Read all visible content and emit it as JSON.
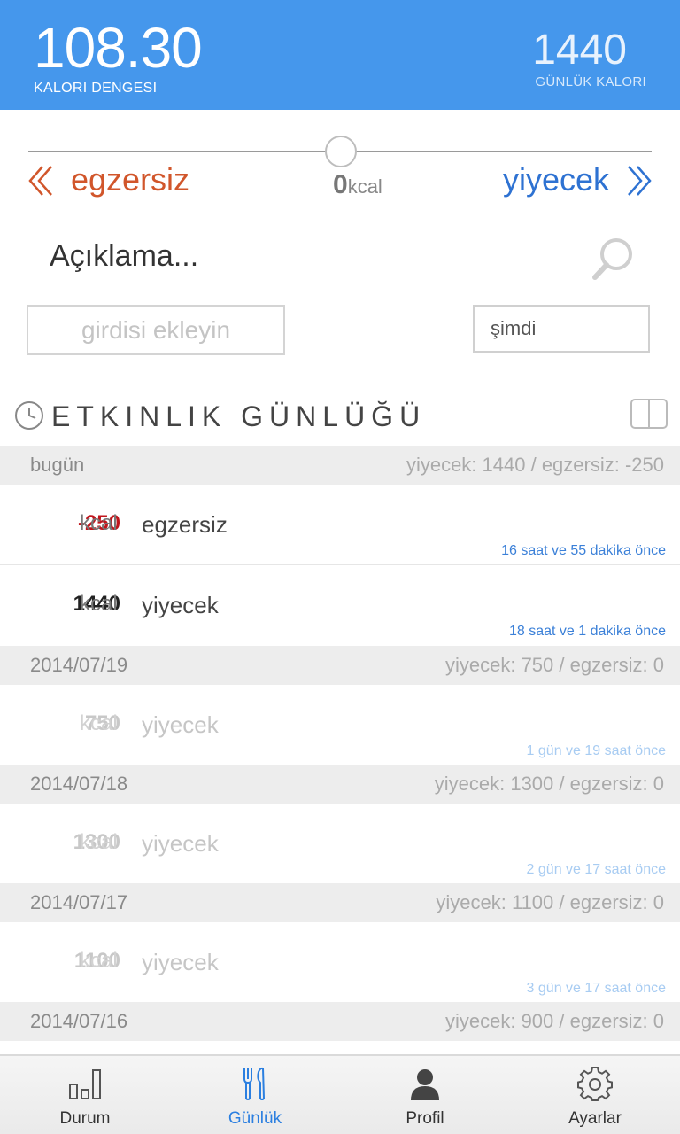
{
  "header": {
    "balance_value": "108.30",
    "balance_label": "KALORI DENGESI",
    "daily_value": "1440",
    "daily_label": "GÜNLÜK KALORI"
  },
  "slider": {
    "exercise_label": "egzersiz",
    "food_label": "yiyecek",
    "kcal_value": "0",
    "kcal_unit": "kcal"
  },
  "form": {
    "description": "Açıklama...",
    "entry_placeholder": "girdisi ekleyin",
    "time_value": "şimdi"
  },
  "log": {
    "title": "ETKINLIK GÜNLÜĞÜ",
    "days": [
      {
        "date": "bugün",
        "summary": "yiyecek: 1440 / egzersiz: -250",
        "entries": [
          {
            "amount": "-250",
            "unit": "kcal",
            "type": "egzersiz",
            "time": "16 saat ve 55 dakika önce"
          },
          {
            "amount": "1440",
            "unit": "kcal",
            "type": "yiyecek",
            "time": "18 saat ve 1 dakika önce"
          }
        ]
      },
      {
        "date": "2014/07/19",
        "summary": "yiyecek: 750 / egzersiz: 0",
        "entries": [
          {
            "amount": "750",
            "unit": "kcal",
            "type": "yiyecek",
            "time": "1 gün ve 19 saat önce"
          }
        ]
      },
      {
        "date": "2014/07/18",
        "summary": "yiyecek: 1300 / egzersiz: 0",
        "entries": [
          {
            "amount": "1300",
            "unit": "kcal",
            "type": "yiyecek",
            "time": "2 gün ve 17 saat önce"
          }
        ]
      },
      {
        "date": "2014/07/17",
        "summary": "yiyecek: 1100 / egzersiz: 0",
        "entries": [
          {
            "amount": "1100",
            "unit": "kcal",
            "type": "yiyecek",
            "time": "3 gün ve 17 saat önce"
          }
        ]
      },
      {
        "date": "2014/07/16",
        "summary": "yiyecek: 900 / egzersiz: 0",
        "entries": []
      }
    ]
  },
  "nav": {
    "items": [
      {
        "label": "Durum",
        "icon": "bar-chart-icon"
      },
      {
        "label": "Günlük",
        "icon": "fork-knife-icon",
        "active": true
      },
      {
        "label": "Profil",
        "icon": "person-icon"
      },
      {
        "label": "Ayarlar",
        "icon": "gear-icon"
      }
    ]
  },
  "colors": {
    "header_bg": "#4597ec",
    "exercise": "#d1562b",
    "food": "#2e72d2",
    "negative_amount": "#c0151c",
    "active_nav": "#2b7fe0"
  }
}
